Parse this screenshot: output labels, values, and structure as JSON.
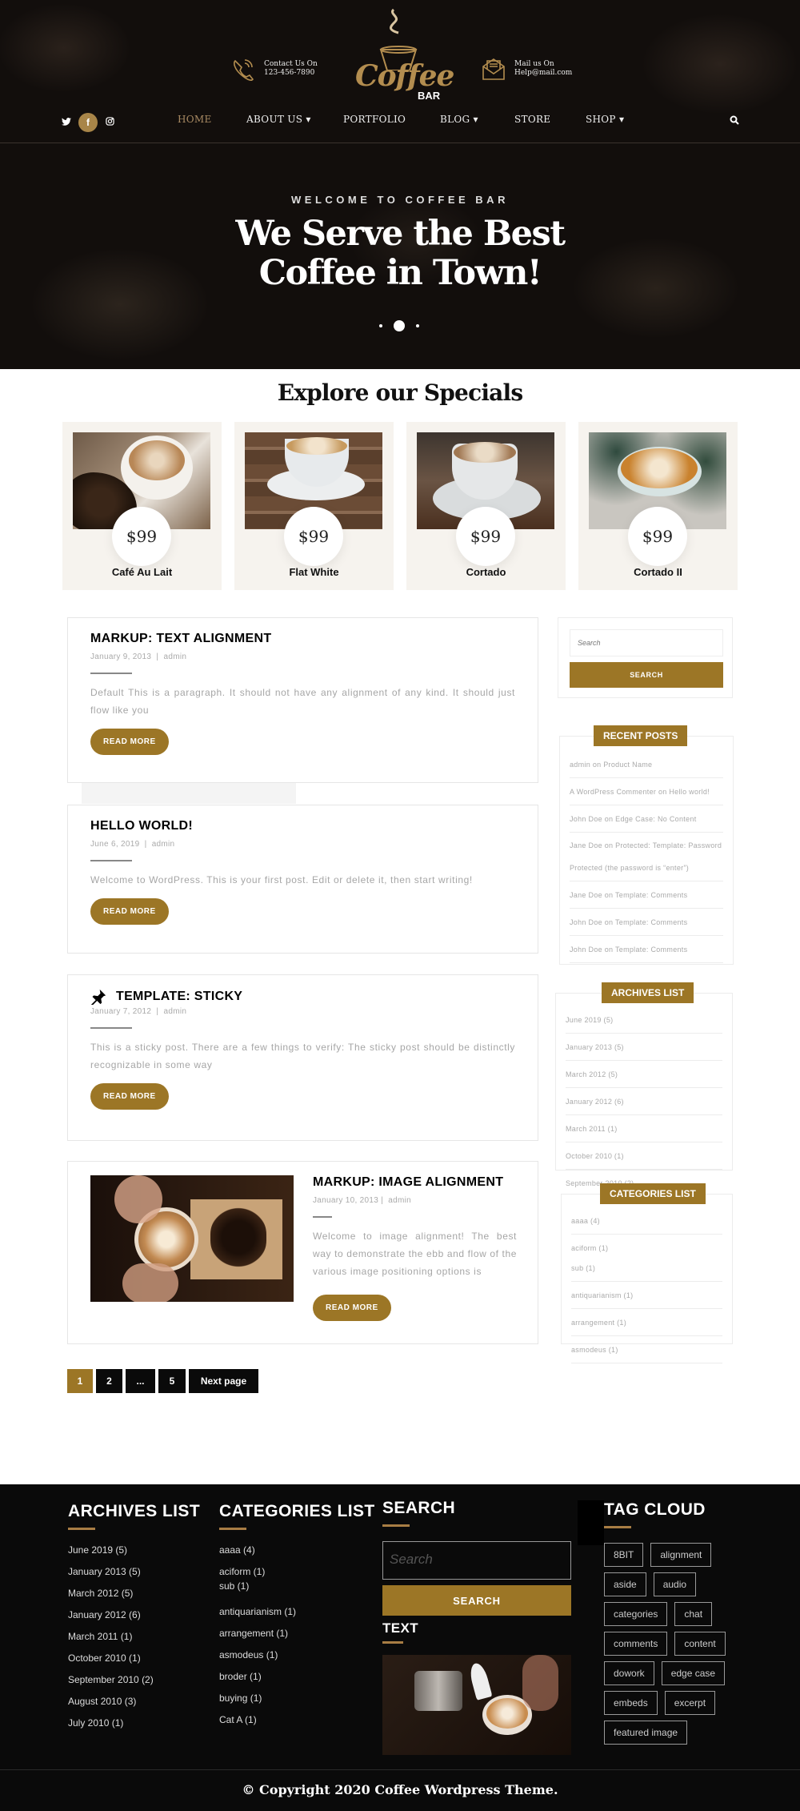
{
  "header": {
    "contact": {
      "label": "Contact Us On",
      "value": "123-456-7890"
    },
    "mail": {
      "label": "Mail us On",
      "value": "Help@mail.com"
    },
    "logo": {
      "word": "Coffee",
      "sub": "BAR"
    },
    "social": {
      "twitter": "twitter-icon",
      "facebook": "f",
      "instagram": "instagram-icon"
    },
    "nav": [
      {
        "label": "HOME",
        "active": true
      },
      {
        "label": "ABOUT US",
        "dropdown": true
      },
      {
        "label": "PORTFOLIO"
      },
      {
        "label": "BLOG",
        "dropdown": true
      },
      {
        "label": "STORE"
      },
      {
        "label": "SHOP",
        "dropdown": true
      }
    ],
    "chevron": "⌄"
  },
  "hero": {
    "eyebrow": "WELCOME TO COFFEE BAR",
    "title_line1": "We Serve the Best",
    "title_line2": "Coffee in Town!",
    "slides": 3,
    "active_slide": 2
  },
  "specials": {
    "title": "Explore our Specials",
    "items": [
      {
        "price": "$99",
        "name": "Café Au Lait"
      },
      {
        "price": "$99",
        "name": "Flat White"
      },
      {
        "price": "$99",
        "name": "Cortado"
      },
      {
        "price": "$99",
        "name": "Cortado II"
      }
    ]
  },
  "posts": [
    {
      "title": "MARKUP: TEXT ALIGNMENT",
      "date": "January 9, 2013",
      "author": "admin",
      "excerpt": "Default This is a paragraph. It should not have any alignment of any kind. It should just flow like you",
      "button": "READ MORE"
    },
    {
      "title": "HELLO WORLD!",
      "date": "June 6, 2019",
      "author": "admin",
      "excerpt": "Welcome to WordPress. This is your first post. Edit or delete it, then start writing!",
      "button": "READ MORE"
    },
    {
      "title": "TEMPLATE: STICKY",
      "date": "January 7, 2012",
      "author": "admin",
      "excerpt": "This is a sticky post. There are a few things to verify: The sticky post should be distinctly recognizable in some way",
      "button": "READ MORE",
      "sticky": true
    },
    {
      "title": "MARKUP: IMAGE ALIGNMENT",
      "date": "January 10, 2013",
      "author": "admin",
      "excerpt": "Welcome to image alignment! The best way to demonstrate the ebb and flow of the various image positioning options is",
      "button": "READ MORE"
    }
  ],
  "meta_separator": "|",
  "pagination": {
    "items": [
      "1",
      "2",
      "...",
      "5"
    ],
    "next": "Next page",
    "current": "1"
  },
  "sidebar": {
    "search": {
      "placeholder": "Search",
      "button": "SEARCH"
    },
    "recent_posts": {
      "title": "RECENT POSTS",
      "items": [
        "admin on Product Name",
        "A WordPress Commenter on Hello world!",
        "John Doe on Edge Case: No Content",
        "Jane Doe on Protected: Template: Password Protected (the password is “enter”)",
        "Jane Doe on Template: Comments",
        "John Doe on Template: Comments",
        "John Doe on Template: Comments"
      ]
    },
    "archives": {
      "title": "ARCHIVES LIST",
      "items": [
        "June 2019 (5)",
        "January 2013 (5)",
        "March 2012 (5)",
        "January 2012 (6)",
        "March 2011 (1)",
        "October 2010 (1)",
        "September 2010 (2)"
      ]
    },
    "categories": {
      "title": "CATEGORIES LIST",
      "items": [
        "aaaa (4)",
        "aciform (1)",
        "sub (1)",
        "antiquarianism (1)",
        "arrangement (1)",
        "asmodeus (1)"
      ]
    }
  },
  "footer": {
    "archives": {
      "title": "ARCHIVES LIST",
      "items": [
        "June 2019 (5)",
        "January 2013 (5)",
        "March 2012 (5)",
        "January 2012 (6)",
        "March 2011 (1)",
        "October 2010 (1)",
        "September 2010 (2)",
        "August 2010 (3)",
        "July 2010 (1)"
      ]
    },
    "categories": {
      "title": "CATEGORIES LIST",
      "items": [
        "aaaa (4)",
        "aciform (1)",
        "sub (1)",
        "antiquarianism (1)",
        "arrangement (1)",
        "asmodeus (1)",
        "broder (1)",
        "buying (1)",
        "Cat A (1)"
      ]
    },
    "search": {
      "title": "SEARCH",
      "placeholder": "Search",
      "button": "SEARCH"
    },
    "text": {
      "title": "TEXT"
    },
    "tag_cloud": {
      "title": "TAG CLOUD",
      "tags": [
        "8BIT",
        "alignment",
        "aside",
        "audio",
        "categories",
        "chat",
        "comments",
        "content",
        "dowork",
        "edge case",
        "embeds",
        "excerpt",
        "featured image"
      ]
    },
    "copyright": "© Copyright 2020 Coffee Wordpress Theme."
  },
  "colors": {
    "accent": "#9c7626",
    "gold": "#a88548",
    "dark": "#0a0a0a"
  }
}
